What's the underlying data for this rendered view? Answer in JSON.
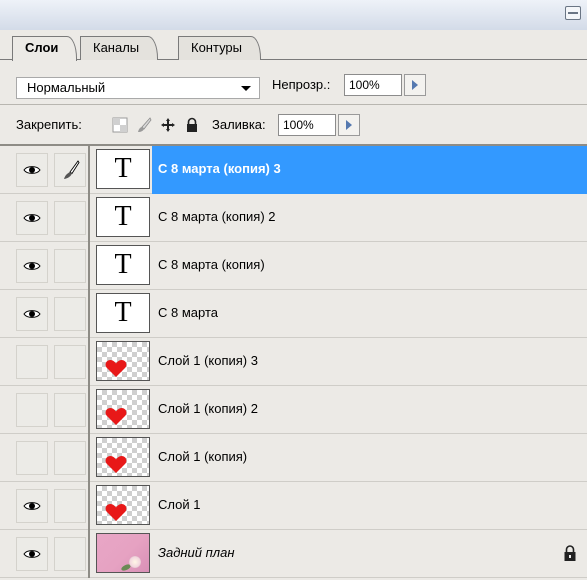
{
  "tabs": [
    {
      "label": "Слои",
      "active": true
    },
    {
      "label": "Каналы",
      "active": false
    },
    {
      "label": "Контуры",
      "active": false
    }
  ],
  "blend": {
    "mode": "Нормальный",
    "opacity_label": "Непрозр.:",
    "opacity_value": "100%"
  },
  "lock": {
    "label": "Закрепить:",
    "fill_label": "Заливка:",
    "fill_value": "100%",
    "icons": [
      "lock-transparent-icon",
      "lock-paint-brush-icon",
      "lock-position-move-icon",
      "lock-all-padlock-icon"
    ]
  },
  "layers": [
    {
      "name": "С 8 марта (копия) 3",
      "type": "text",
      "visible": true,
      "linked_brush": true,
      "selected": true
    },
    {
      "name": "С 8 марта (копия) 2",
      "type": "text",
      "visible": true,
      "linked_brush": false,
      "selected": false
    },
    {
      "name": "С 8 марта (копия)",
      "type": "text",
      "visible": true,
      "linked_brush": false,
      "selected": false
    },
    {
      "name": "С 8 марта",
      "type": "text",
      "visible": true,
      "linked_brush": false,
      "selected": false
    },
    {
      "name": "Слой 1 (копия) 3",
      "type": "heart",
      "visible": false,
      "linked_brush": false,
      "selected": false
    },
    {
      "name": "Слой 1 (копия) 2",
      "type": "heart",
      "visible": false,
      "linked_brush": false,
      "selected": false
    },
    {
      "name": "Слой 1 (копия)",
      "type": "heart",
      "visible": false,
      "linked_brush": false,
      "selected": false
    },
    {
      "name": "Слой 1",
      "type": "heart",
      "visible": true,
      "linked_brush": false,
      "selected": false
    },
    {
      "name": "Задний план",
      "type": "background",
      "visible": true,
      "linked_brush": false,
      "selected": false,
      "locked": true
    }
  ],
  "text_thumb_glyph": "T",
  "colors": {
    "selection": "#3399ff",
    "heart": "#e81818",
    "panel_bg": "#eceae6"
  }
}
